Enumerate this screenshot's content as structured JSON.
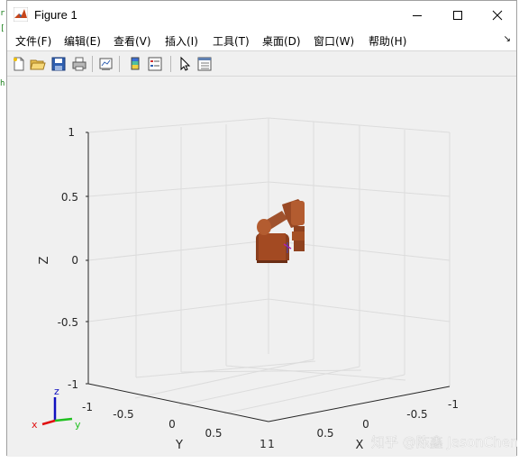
{
  "window": {
    "title": "Figure 1"
  },
  "menu": {
    "items": [
      {
        "label": "文件(F)"
      },
      {
        "label": "编辑(E)"
      },
      {
        "label": "查看(V)"
      },
      {
        "label": "插入(I)"
      },
      {
        "label": "工具(T)"
      },
      {
        "label": "桌面(D)"
      },
      {
        "label": "窗口(W)"
      },
      {
        "label": "帮助(H)"
      }
    ],
    "pin_icon": "dock-arrow-icon"
  },
  "toolbar": {
    "icons": [
      "new-figure-icon",
      "open-file-icon",
      "save-icon",
      "print-icon",
      "link-plot-icon",
      "insert-colorbar-icon",
      "insert-legend-icon",
      "edit-plot-arrow-icon",
      "property-inspector-icon"
    ]
  },
  "axes": {
    "zlabel": "Z",
    "ylabel": "Y",
    "xlabel": "X",
    "z_ticks": [
      "1",
      "0.5",
      "0",
      "-0.5",
      "-1"
    ],
    "y_ticks": [
      "-1",
      "-0.5",
      "0",
      "0.5",
      "1"
    ],
    "x_ticks": [
      "1",
      "0.5",
      "0",
      "-0.5",
      "-1"
    ],
    "colors": {
      "robot": "#a0522d",
      "grid": "#dcdcdc",
      "axis": "#262626"
    }
  },
  "triad": {
    "z": "z",
    "x": "x",
    "y": "y"
  },
  "watermark": "知乎 @陈鑫 JasonChen",
  "side_strip": [
    "r",
    "[",
    "h"
  ]
}
